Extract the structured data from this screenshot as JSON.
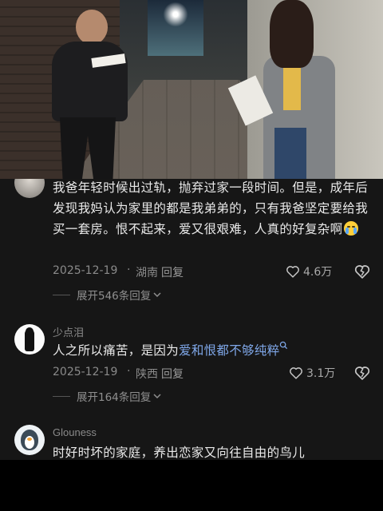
{
  "comments": [
    {
      "username": "",
      "text": "我爸年轻时候出过轨，抛弃过家一段时间。但是，成年后发现我妈认为家里的都是我弟弟的，只有我爸坚定要给我买一套房。恨不起来，爱又很艰难，人真的好复杂啊",
      "emoji": "loudly-crying-face",
      "date": "2025-12-19",
      "separator": "·",
      "region": "湖南",
      "reply_label": "回复",
      "likes": "4.6万",
      "replies_label": "展开546条回复"
    },
    {
      "username": "少点泪",
      "text_before": "人之所以痛苦，是因为",
      "text_highlight": "爱和恨都不够纯粹",
      "date": "2025-12-19",
      "separator": "·",
      "region": "陕西",
      "reply_label": "回复",
      "likes": "3.1万",
      "replies_label": "展开164条回复"
    },
    {
      "username": "Glouness",
      "text": "时好时坏的家庭，养出恋家又向往自由的鸟儿"
    }
  ],
  "colors": {
    "background": "#161616",
    "highlight": "#7fa7e8",
    "secondary_text": "#8a8a8a"
  }
}
